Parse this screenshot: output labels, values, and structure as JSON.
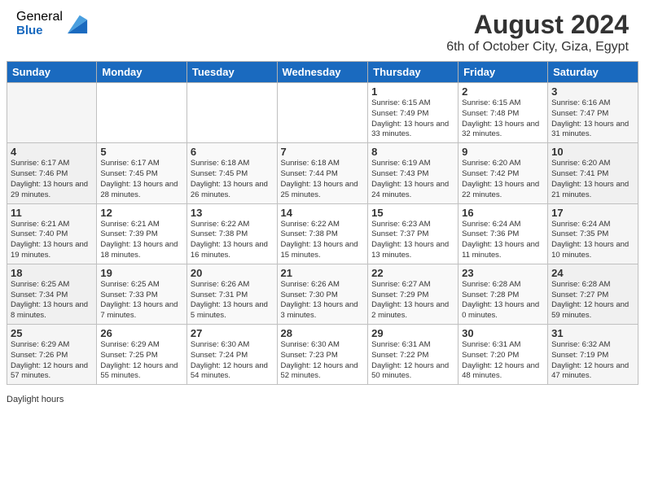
{
  "logo": {
    "general": "General",
    "blue": "Blue"
  },
  "title": "August 2024",
  "subtitle": "6th of October City, Giza, Egypt",
  "days_of_week": [
    "Sunday",
    "Monday",
    "Tuesday",
    "Wednesday",
    "Thursday",
    "Friday",
    "Saturday"
  ],
  "weeks": [
    [
      {
        "day": "",
        "info": ""
      },
      {
        "day": "",
        "info": ""
      },
      {
        "day": "",
        "info": ""
      },
      {
        "day": "",
        "info": ""
      },
      {
        "day": "1",
        "info": "Sunrise: 6:15 AM\nSunset: 7:49 PM\nDaylight: 13 hours and 33 minutes."
      },
      {
        "day": "2",
        "info": "Sunrise: 6:15 AM\nSunset: 7:48 PM\nDaylight: 13 hours and 32 minutes."
      },
      {
        "day": "3",
        "info": "Sunrise: 6:16 AM\nSunset: 7:47 PM\nDaylight: 13 hours and 31 minutes."
      }
    ],
    [
      {
        "day": "4",
        "info": "Sunrise: 6:17 AM\nSunset: 7:46 PM\nDaylight: 13 hours and 29 minutes."
      },
      {
        "day": "5",
        "info": "Sunrise: 6:17 AM\nSunset: 7:45 PM\nDaylight: 13 hours and 28 minutes."
      },
      {
        "day": "6",
        "info": "Sunrise: 6:18 AM\nSunset: 7:45 PM\nDaylight: 13 hours and 26 minutes."
      },
      {
        "day": "7",
        "info": "Sunrise: 6:18 AM\nSunset: 7:44 PM\nDaylight: 13 hours and 25 minutes."
      },
      {
        "day": "8",
        "info": "Sunrise: 6:19 AM\nSunset: 7:43 PM\nDaylight: 13 hours and 24 minutes."
      },
      {
        "day": "9",
        "info": "Sunrise: 6:20 AM\nSunset: 7:42 PM\nDaylight: 13 hours and 22 minutes."
      },
      {
        "day": "10",
        "info": "Sunrise: 6:20 AM\nSunset: 7:41 PM\nDaylight: 13 hours and 21 minutes."
      }
    ],
    [
      {
        "day": "11",
        "info": "Sunrise: 6:21 AM\nSunset: 7:40 PM\nDaylight: 13 hours and 19 minutes."
      },
      {
        "day": "12",
        "info": "Sunrise: 6:21 AM\nSunset: 7:39 PM\nDaylight: 13 hours and 18 minutes."
      },
      {
        "day": "13",
        "info": "Sunrise: 6:22 AM\nSunset: 7:38 PM\nDaylight: 13 hours and 16 minutes."
      },
      {
        "day": "14",
        "info": "Sunrise: 6:22 AM\nSunset: 7:38 PM\nDaylight: 13 hours and 15 minutes."
      },
      {
        "day": "15",
        "info": "Sunrise: 6:23 AM\nSunset: 7:37 PM\nDaylight: 13 hours and 13 minutes."
      },
      {
        "day": "16",
        "info": "Sunrise: 6:24 AM\nSunset: 7:36 PM\nDaylight: 13 hours and 11 minutes."
      },
      {
        "day": "17",
        "info": "Sunrise: 6:24 AM\nSunset: 7:35 PM\nDaylight: 13 hours and 10 minutes."
      }
    ],
    [
      {
        "day": "18",
        "info": "Sunrise: 6:25 AM\nSunset: 7:34 PM\nDaylight: 13 hours and 8 minutes."
      },
      {
        "day": "19",
        "info": "Sunrise: 6:25 AM\nSunset: 7:33 PM\nDaylight: 13 hours and 7 minutes."
      },
      {
        "day": "20",
        "info": "Sunrise: 6:26 AM\nSunset: 7:31 PM\nDaylight: 13 hours and 5 minutes."
      },
      {
        "day": "21",
        "info": "Sunrise: 6:26 AM\nSunset: 7:30 PM\nDaylight: 13 hours and 3 minutes."
      },
      {
        "day": "22",
        "info": "Sunrise: 6:27 AM\nSunset: 7:29 PM\nDaylight: 13 hours and 2 minutes."
      },
      {
        "day": "23",
        "info": "Sunrise: 6:28 AM\nSunset: 7:28 PM\nDaylight: 13 hours and 0 minutes."
      },
      {
        "day": "24",
        "info": "Sunrise: 6:28 AM\nSunset: 7:27 PM\nDaylight: 12 hours and 59 minutes."
      }
    ],
    [
      {
        "day": "25",
        "info": "Sunrise: 6:29 AM\nSunset: 7:26 PM\nDaylight: 12 hours and 57 minutes."
      },
      {
        "day": "26",
        "info": "Sunrise: 6:29 AM\nSunset: 7:25 PM\nDaylight: 12 hours and 55 minutes."
      },
      {
        "day": "27",
        "info": "Sunrise: 6:30 AM\nSunset: 7:24 PM\nDaylight: 12 hours and 54 minutes."
      },
      {
        "day": "28",
        "info": "Sunrise: 6:30 AM\nSunset: 7:23 PM\nDaylight: 12 hours and 52 minutes."
      },
      {
        "day": "29",
        "info": "Sunrise: 6:31 AM\nSunset: 7:22 PM\nDaylight: 12 hours and 50 minutes."
      },
      {
        "day": "30",
        "info": "Sunrise: 6:31 AM\nSunset: 7:20 PM\nDaylight: 12 hours and 48 minutes."
      },
      {
        "day": "31",
        "info": "Sunrise: 6:32 AM\nSunset: 7:19 PM\nDaylight: 12 hours and 47 minutes."
      }
    ]
  ],
  "daylight_label": "Daylight hours"
}
